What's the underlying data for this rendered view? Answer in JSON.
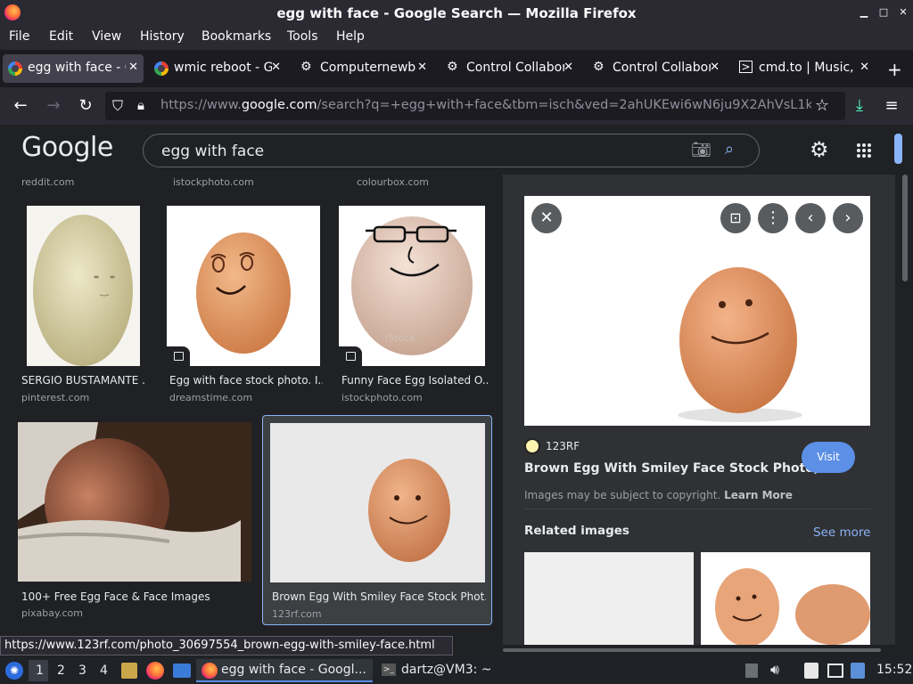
{
  "window": {
    "title": "egg with face - Google Search — Mozilla Firefox"
  },
  "menu": [
    "File",
    "Edit",
    "View",
    "History",
    "Bookmarks",
    "Tools",
    "Help"
  ],
  "tabs": [
    {
      "label": "egg with face - Go",
      "icon": "google-icon"
    },
    {
      "label": "wmic reboot - Go",
      "icon": "google-icon"
    },
    {
      "label": "Computernewb",
      "icon": "puzzle-icon"
    },
    {
      "label": "Control Collabora",
      "icon": "puzzle-icon"
    },
    {
      "label": "Control Collabora",
      "icon": "puzzle-icon"
    },
    {
      "label": "cmd.to | Music,",
      "icon": "terminal-icon"
    }
  ],
  "nav": {
    "url_prefix": "https://www.",
    "url_domain": "google.com",
    "url_rest": "/search?q=+egg+with+face&tbm=isch&ved=2ahUKEwi6wN6ju9X2AhVsL1kFH"
  },
  "google": {
    "logo": "Google",
    "query": "egg with face"
  },
  "results": {
    "top_sources": [
      "reddit.com",
      "istockphoto.com",
      "colourbox.com"
    ],
    "row1": [
      {
        "title": "SERGIO BUSTAMANTE ...",
        "source": "pinterest.com"
      },
      {
        "title": "Egg with face stock photo. I...",
        "source": "dreamstime.com"
      },
      {
        "title": "Funny Face Egg Isolated O...",
        "source": "istockphoto.com"
      }
    ],
    "row2": [
      {
        "title": "100+ Free Egg Face & Face Images",
        "source": "pixabay.com"
      },
      {
        "title": "Brown Egg With Smiley Face Stock Phot...",
        "source": "123rf.com"
      }
    ],
    "watermark": "iStock"
  },
  "preview": {
    "site": "123RF",
    "title": "Brown Egg With Smiley Face Stock Photo, ...",
    "visit": "Visit",
    "copyright": "Images may be subject to copyright.",
    "learn_more": "Learn More",
    "related": "Related images",
    "see_more": "See more"
  },
  "status_url": "https://www.123rf.com/photo_30697554_brown-egg-with-smiley-face.html",
  "taskbar": {
    "workspaces": [
      "1",
      "2",
      "3",
      "4"
    ],
    "tasks": [
      "egg with face - Googl...",
      "dartz@VM3: ~"
    ],
    "clock": "15:52"
  },
  "colors": {
    "accent": "#8ab4f8",
    "visit_btn": "#5c8fe6",
    "bg": "#202124"
  }
}
